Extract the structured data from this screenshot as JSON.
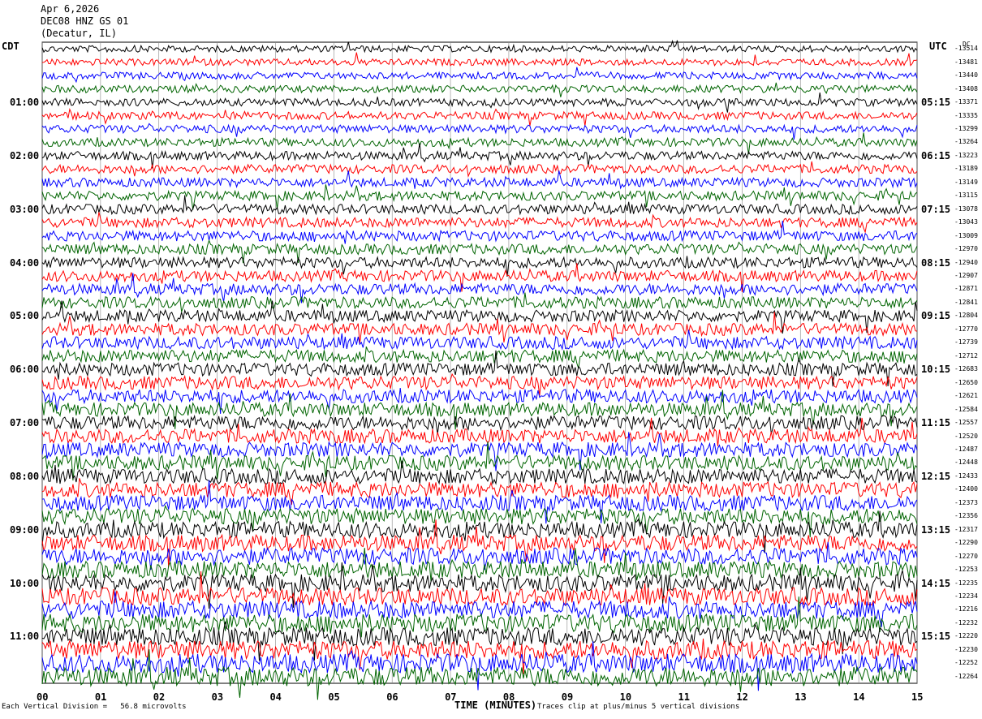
{
  "header": {
    "date": "Apr 6,2026",
    "station": "DEC08 HNZ GS 01",
    "location": "(Decatur, IL)"
  },
  "left_axis_label": "CDT",
  "right_axis_label": "UTC",
  "dc_label": "DC",
  "chart_data": {
    "type": "helicorder",
    "xlabel": "TIME (MINUTES)",
    "x_ticks": [
      "00",
      "01",
      "02",
      "03",
      "04",
      "05",
      "06",
      "07",
      "08",
      "09",
      "10",
      "11",
      "12",
      "13",
      "14",
      "15"
    ],
    "local_hours": [
      "01:00",
      "02:00",
      "03:00",
      "04:00",
      "05:00",
      "06:00",
      "07:00",
      "08:00",
      "09:00",
      "10:00",
      "11:00"
    ],
    "utc_hours": [
      "05:15",
      "06:15",
      "07:15",
      "08:15",
      "09:15",
      "10:15",
      "11:15",
      "12:15",
      "13:15",
      "14:15",
      "15:15"
    ],
    "dc_offsets": [
      "-13514",
      "-13481",
      "-13440",
      "-13408",
      "-13371",
      "-13335",
      "-13299",
      "-13264",
      "-13223",
      "-13189",
      "-13149",
      "-13115",
      "-13078",
      "-13043",
      "-13009",
      "-12970",
      "-12940",
      "-12907",
      "-12871",
      "-12841",
      "-12804",
      "-12770",
      "-12739",
      "-12712",
      "-12683",
      "-12650",
      "-12621",
      "-12584",
      "-12557",
      "-12520",
      "-12487",
      "-12448",
      "-12433",
      "-12400",
      "-12373",
      "-12356",
      "-12317",
      "-12290",
      "-12270",
      "-12253",
      "-12235",
      "-12234",
      "-12216",
      "-12232",
      "-12220",
      "-12230",
      "-12252",
      "-12264"
    ],
    "trace_colors": [
      "#000000",
      "#ff0000",
      "#0000ff",
      "#006400"
    ],
    "num_traces": 48,
    "minutes_per_line": 15
  },
  "footer": {
    "vertical_division": "Each Vertical Division =   56.8 microvolts",
    "traces_note": "Traces clip at plus/minus 5 vertical divisions"
  }
}
